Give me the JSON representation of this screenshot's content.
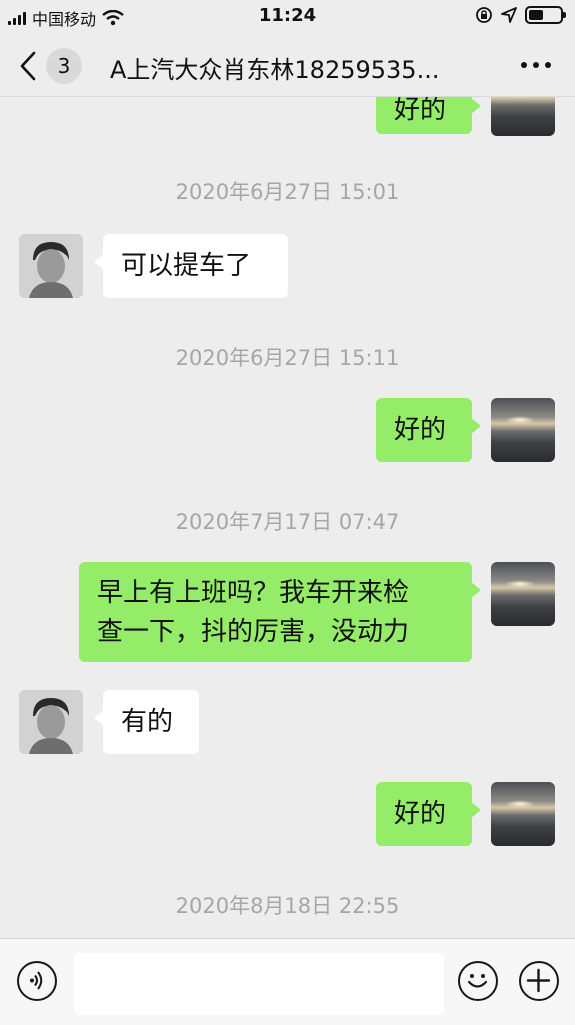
{
  "status_bar": {
    "carrier": "中国移动",
    "time": "11:24",
    "battery_level": 0.45
  },
  "nav": {
    "unread_count": "3",
    "title": "A上汽大众肖东林18259535..."
  },
  "messages": {
    "m1": {
      "text": "好的"
    },
    "ts1": {
      "text": "2020年6月27日 15:01"
    },
    "m2": {
      "text": "可以提车了"
    },
    "ts2": {
      "text": "2020年6月27日 15:11"
    },
    "m3": {
      "text": "好的"
    },
    "ts3": {
      "text": "2020年7月17日 07:47"
    },
    "m4": {
      "line1": "早上有上班吗？我车开来检",
      "line2": "查一下，抖的厉害，没动力"
    },
    "m5": {
      "text": "有的"
    },
    "m6": {
      "text": "好的"
    },
    "ts4": {
      "text": "2020年8月18日 22:55"
    }
  },
  "colors": {
    "sent_bubble": "#95ec69",
    "received_bubble": "#ffffff",
    "background": "#ededed"
  }
}
